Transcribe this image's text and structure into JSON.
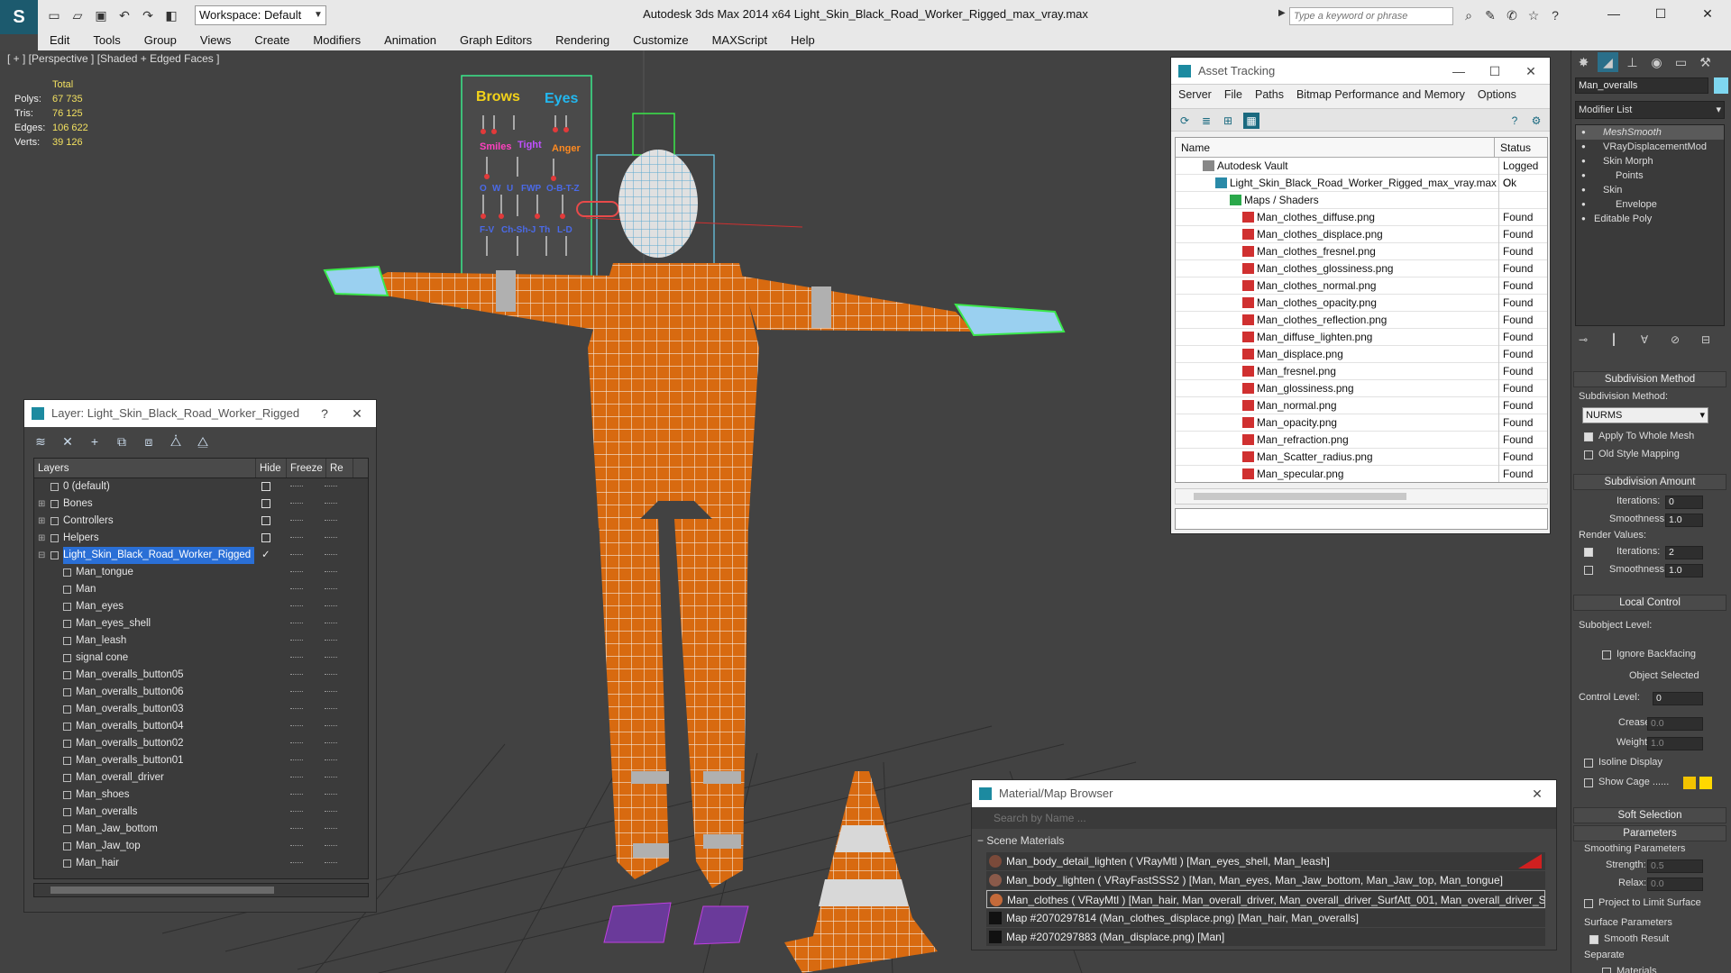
{
  "titlebar": {
    "logo": "S",
    "workspace": "Workspace: Default",
    "title": "Autodesk 3ds Max  2014 x64      Light_Skin_Black_Road_Worker_Rigged_max_vray.max",
    "search_placeholder": "Type a keyword or phrase"
  },
  "menu": [
    "Edit",
    "Tools",
    "Group",
    "Views",
    "Create",
    "Modifiers",
    "Animation",
    "Graph Editors",
    "Rendering",
    "Customize",
    "MAXScript",
    "Help"
  ],
  "viewport": {
    "label": "[ + ] [Perspective ] [Shaded + Edged Faces ]",
    "stats": {
      "header": "Total",
      "rows": [
        {
          "k": "Polys:",
          "v": "67 735"
        },
        {
          "k": "Tris:",
          "v": "76 125"
        },
        {
          "k": "Edges:",
          "v": "106 622"
        },
        {
          "k": "Verts:",
          "v": "39 126"
        }
      ]
    },
    "board": {
      "brows": "Brows",
      "eyes": "Eyes",
      "smiles": "Smiles",
      "tight": "Tight",
      "anger": "Anger",
      "row3": [
        "O",
        "W",
        "U",
        "FWP",
        "O-B-T-Z"
      ],
      "row4": [
        "F-V",
        "Ch-Sh-J",
        "Th",
        "L-D"
      ]
    }
  },
  "layers": {
    "title": "Layer: Light_Skin_Black_Road_Worker_Rigged",
    "help": "?",
    "close": "✕",
    "col_layers": "Layers",
    "col_hide": "Hide",
    "col_freeze": "Freeze",
    "col_render": "Re",
    "rows": [
      {
        "name": "0 (default)",
        "level": 0,
        "box": true
      },
      {
        "name": "Bones",
        "level": 0,
        "box": true,
        "plus": true
      },
      {
        "name": "Controllers",
        "level": 0,
        "box": true,
        "plus": true
      },
      {
        "name": "Helpers",
        "level": 0,
        "box": true,
        "plus": true
      },
      {
        "name": "Light_Skin_Black_Road_Worker_Rigged",
        "level": 0,
        "sel": true,
        "check": true,
        "minus": true
      },
      {
        "name": "Man_tongue",
        "level": 1
      },
      {
        "name": "Man",
        "level": 1
      },
      {
        "name": "Man_eyes",
        "level": 1
      },
      {
        "name": "Man_eyes_shell",
        "level": 1
      },
      {
        "name": "Man_leash",
        "level": 1
      },
      {
        "name": "signal cone",
        "level": 1
      },
      {
        "name": "Man_overalls_button05",
        "level": 1
      },
      {
        "name": "Man_overalls_button06",
        "level": 1
      },
      {
        "name": "Man_overalls_button03",
        "level": 1
      },
      {
        "name": "Man_overalls_button04",
        "level": 1
      },
      {
        "name": "Man_overalls_button02",
        "level": 1
      },
      {
        "name": "Man_overalls_button01",
        "level": 1
      },
      {
        "name": "Man_overall_driver",
        "level": 1
      },
      {
        "name": "Man_shoes",
        "level": 1
      },
      {
        "name": "Man_overalls",
        "level": 1
      },
      {
        "name": "Man_Jaw_bottom",
        "level": 1
      },
      {
        "name": "Man_Jaw_top",
        "level": 1
      },
      {
        "name": "Man_hair",
        "level": 1
      }
    ]
  },
  "asset": {
    "title": "Asset Tracking",
    "menu": [
      "Server",
      "File",
      "Paths",
      "Bitmap Performance and Memory",
      "Options"
    ],
    "col_name": "Name",
    "col_status": "Status",
    "rows": [
      {
        "name": "Autodesk Vault",
        "status": "Logged O",
        "indent": 30,
        "type": "vault"
      },
      {
        "name": "Light_Skin_Black_Road_Worker_Rigged_max_vray.max",
        "status": "Ok",
        "indent": 44,
        "type": "max"
      },
      {
        "name": "Maps / Shaders",
        "status": "",
        "indent": 60,
        "type": "maps"
      },
      {
        "name": "Man_clothes_diffuse.png",
        "status": "Found",
        "indent": 74,
        "type": "png"
      },
      {
        "name": "Man_clothes_displace.png",
        "status": "Found",
        "indent": 74,
        "type": "png"
      },
      {
        "name": "Man_clothes_fresnel.png",
        "status": "Found",
        "indent": 74,
        "type": "png"
      },
      {
        "name": "Man_clothes_glossiness.png",
        "status": "Found",
        "indent": 74,
        "type": "png"
      },
      {
        "name": "Man_clothes_normal.png",
        "status": "Found",
        "indent": 74,
        "type": "png"
      },
      {
        "name": "Man_clothes_opacity.png",
        "status": "Found",
        "indent": 74,
        "type": "png"
      },
      {
        "name": "Man_clothes_reflection.png",
        "status": "Found",
        "indent": 74,
        "type": "png"
      },
      {
        "name": "Man_diffuse_lighten.png",
        "status": "Found",
        "indent": 74,
        "type": "png"
      },
      {
        "name": "Man_displace.png",
        "status": "Found",
        "indent": 74,
        "type": "png"
      },
      {
        "name": "Man_fresnel.png",
        "status": "Found",
        "indent": 74,
        "type": "png"
      },
      {
        "name": "Man_glossiness.png",
        "status": "Found",
        "indent": 74,
        "type": "png"
      },
      {
        "name": "Man_normal.png",
        "status": "Found",
        "indent": 74,
        "type": "png"
      },
      {
        "name": "Man_opacity.png",
        "status": "Found",
        "indent": 74,
        "type": "png"
      },
      {
        "name": "Man_refraction.png",
        "status": "Found",
        "indent": 74,
        "type": "png"
      },
      {
        "name": "Man_Scatter_radius.png",
        "status": "Found",
        "indent": 74,
        "type": "png"
      },
      {
        "name": "Man_specular.png",
        "status": "Found",
        "indent": 74,
        "type": "png"
      }
    ]
  },
  "material": {
    "title": "Material/Map Browser",
    "search_placeholder": "Search by Name ...",
    "section": "Scene Materials",
    "rows": [
      {
        "text": "Man_body_detail_lighten  ( VRayMtl ) [Man_eyes_shell, Man_leash]",
        "swatch": "#7a4a3a"
      },
      {
        "text": "Man_body_lighten  ( VRayFastSSS2 ) [Man, Man_eyes, Man_Jaw_bottom, Man_Jaw_top, Man_tongue]",
        "swatch": "#8a5a4a"
      },
      {
        "text": "Man_clothes  ( VRayMtl ) [Man_hair, Man_overall_driver, Man_overall_driver_SurfAtt_001, Man_overall_driver_Surf...",
        "swatch": "#c46a3a",
        "sel": true
      },
      {
        "text": "Map #2070297814 (Man_clothes_displace.png) [Man_hair, Man_overalls]",
        "swatch": "#111"
      },
      {
        "text": "Map #2070297883 (Man_displace.png)  [Man]",
        "swatch": "#111"
      }
    ]
  },
  "command": {
    "object_name": "Man_overalls",
    "modifier_list": "Modifier List",
    "stack": [
      {
        "name": "MeshSmooth",
        "sel": true,
        "indent": 30
      },
      {
        "name": "VRayDisplacementMod",
        "indent": 30
      },
      {
        "name": "Skin Morph",
        "indent": 30
      },
      {
        "name": "Points",
        "indent": 44
      },
      {
        "name": "Skin",
        "indent": 30
      },
      {
        "name": "Envelope",
        "indent": 44
      },
      {
        "name": "Editable Poly",
        "indent": 20
      }
    ],
    "subdiv_method_header": "Subdivision Method",
    "subdiv_method_label": "Subdivision Method:",
    "subdiv_method_value": "NURMS",
    "apply_whole": "Apply To Whole Mesh",
    "old_style": "Old Style Mapping",
    "subdiv_amount_header": "Subdivision Amount",
    "iterations_label": "Iterations:",
    "iterations": "0",
    "smoothness_label": "Smoothness:",
    "smoothness": "1.0",
    "render_values": "Render Values:",
    "r_iterations_label": "Iterations:",
    "r_iterations": "2",
    "r_smoothness_label": "Smoothness:",
    "r_smoothness": "1.0",
    "local_control_header": "Local Control",
    "subobject_label": "Subobject Level:",
    "ignore_backfacing": "Ignore Backfacing",
    "object_selected": "Object Selected",
    "control_level_label": "Control Level:",
    "control_level": "0",
    "crease_label": "Crease:",
    "crease": "0.0",
    "weight_label": "Weight:",
    "weight": "1.0",
    "isoline": "Isoline Display",
    "show_cage": "Show Cage ......",
    "soft_selection_header": "Soft Selection",
    "parameters_header": "Parameters",
    "smoothing_params": "Smoothing Parameters",
    "strength_label": "Strength:",
    "strength": "0.5",
    "relax_label": "Relax:",
    "relax": "0.0",
    "project_limit": "Project to Limit Surface",
    "surface_params": "Surface Parameters",
    "smooth_result": "Smooth Result",
    "separate": "Separate",
    "materials": "Materials"
  }
}
